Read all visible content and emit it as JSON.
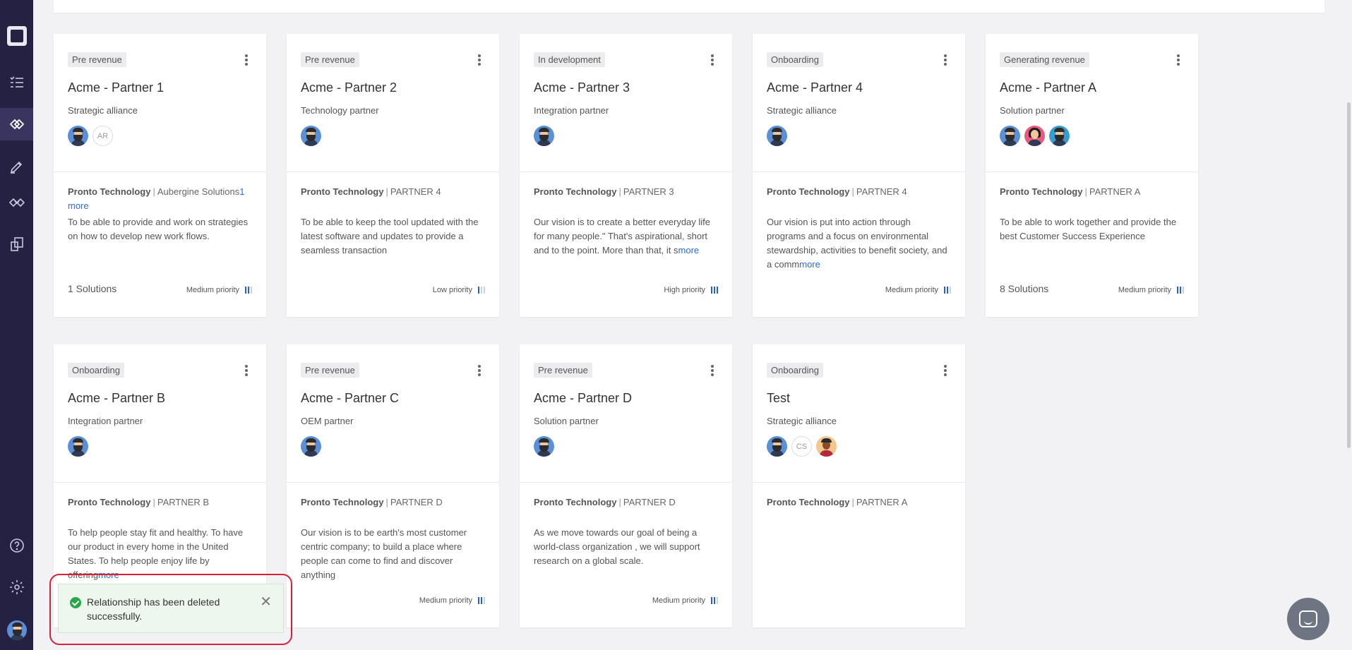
{
  "sidebar": {
    "items": [
      {
        "name": "app-logo-icon"
      },
      {
        "name": "tasks-icon"
      },
      {
        "name": "relationships-icon"
      },
      {
        "name": "pen-icon"
      },
      {
        "name": "handshake-icon"
      },
      {
        "name": "documents-icon"
      }
    ],
    "bottom": [
      {
        "name": "help-icon"
      },
      {
        "name": "settings-icon"
      },
      {
        "name": "user-avatar"
      }
    ]
  },
  "cards": [
    {
      "tag": "Pre revenue",
      "title": "Acme - Partner 1",
      "subtitle": "Strategic alliance",
      "avatars": [
        "a1",
        "AR"
      ],
      "company": "Pronto Technology",
      "partner": "Aubergine Solutions",
      "partner_more": "1 more",
      "description": "To be able to provide and work on strategies on how to develop new work flows.",
      "desc_more": "",
      "solutions": "1 Solutions",
      "priority": "Medium priority",
      "priority_level": 2
    },
    {
      "tag": "Pre revenue",
      "title": "Acme - Partner 2",
      "subtitle": "Technology partner",
      "avatars": [
        "a1"
      ],
      "company": "Pronto Technology",
      "partner": "PARTNER 4",
      "partner_more": "",
      "description": "To be able to keep the tool updated with the latest software and updates to provide a seamless transaction",
      "desc_more": "",
      "solutions": "",
      "priority": "Low priority",
      "priority_level": 1
    },
    {
      "tag": "In development",
      "title": "Acme - Partner 3",
      "subtitle": "Integration partner",
      "avatars": [
        "a1"
      ],
      "company": "Pronto Technology",
      "partner": "PARTNER 3",
      "partner_more": "",
      "description": "Our vision is to create a better everyday life for many people.\" That's aspirational, short and to the point. More than that, it s",
      "desc_more": "more",
      "solutions": "",
      "priority": "High priority",
      "priority_level": 3
    },
    {
      "tag": "Onboarding",
      "title": "Acme - Partner 4",
      "subtitle": "Strategic alliance",
      "avatars": [
        "a1"
      ],
      "company": "Pronto Technology",
      "partner": "PARTNER 4",
      "partner_more": "",
      "description": "Our vision is put into action through programs and a focus on environmental stewardship, activities to benefit society, and a comm",
      "desc_more": "more",
      "solutions": "",
      "priority": "Medium priority",
      "priority_level": 2
    },
    {
      "tag": "Generating revenue",
      "title": "Acme - Partner A",
      "subtitle": "Solution partner",
      "avatars": [
        "a1",
        "a2",
        "a3"
      ],
      "company": "Pronto Technology",
      "partner": "PARTNER A",
      "partner_more": "",
      "description": "To be able to work together and provide the best Customer Success Experience",
      "desc_more": "",
      "solutions": "8 Solutions",
      "priority": "Medium priority",
      "priority_level": 2
    },
    {
      "tag": "Onboarding",
      "title": "Acme - Partner B",
      "subtitle": "Integration partner",
      "avatars": [
        "a1"
      ],
      "company": "Pronto Technology",
      "partner": "PARTNER B",
      "partner_more": "",
      "description": "To help people stay fit and healthy. To have our product in every home in the United States. To help people enjoy life by offering",
      "desc_more": "more",
      "solutions": "",
      "priority": "",
      "priority_level": 0
    },
    {
      "tag": "Pre revenue",
      "title": "Acme - Partner C",
      "subtitle": "OEM partner",
      "avatars": [
        "a1"
      ],
      "company": "Pronto Technology",
      "partner": "PARTNER D",
      "partner_more": "",
      "description": "Our vision is to be earth's most customer centric company; to build a place where people can come to find and discover anything",
      "desc_more": "",
      "solutions": "",
      "priority": "Medium priority",
      "priority_level": 2
    },
    {
      "tag": "Pre revenue",
      "title": "Acme - Partner D",
      "subtitle": "Solution partner",
      "avatars": [
        "a1"
      ],
      "company": "Pronto Technology",
      "partner": "PARTNER D",
      "partner_more": "",
      "description": "As we move towards our goal of being a world-class organization , we will support research on a global scale.",
      "desc_more": "",
      "solutions": "",
      "priority": "Medium priority",
      "priority_level": 2
    },
    {
      "tag": "Onboarding",
      "title": "Test",
      "subtitle": "Strategic alliance",
      "avatars": [
        "a1",
        "CS",
        "a4"
      ],
      "company": "Pronto Technology",
      "partner": "PARTNER A",
      "partner_more": "",
      "description": "",
      "desc_more": "",
      "solutions": "",
      "priority": "",
      "priority_level": 0
    }
  ],
  "toast": {
    "message": "Relationship has been deleted successfully.",
    "close": "✕"
  },
  "chat": {
    "icon": "chat-icon"
  }
}
